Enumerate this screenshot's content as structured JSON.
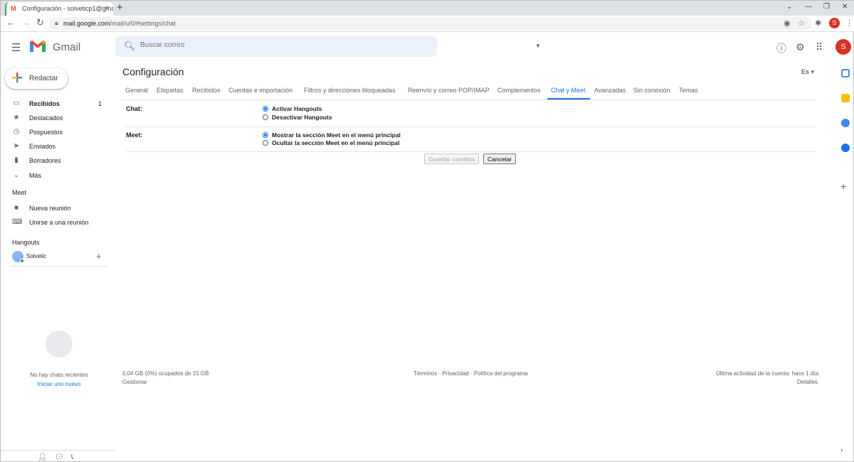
{
  "browser": {
    "tab_title": "Configuración - solveticp1@gmai",
    "tab_close": "×",
    "new_tab": "+",
    "url_host": "mail.google.com",
    "url_path": "/mail/u/0/#settings/chat",
    "profile_initial": "S",
    "window_controls": [
      "⌄",
      "—",
      "❐",
      "✕"
    ]
  },
  "header": {
    "app_name": "Gmail",
    "search_placeholder": "Buscar correo",
    "avatar_initial": "S"
  },
  "sidebar": {
    "compose_label": "Redactar",
    "items": [
      {
        "label": "Recibidos",
        "icon": "inbox-icon",
        "count": "1",
        "bold": true
      },
      {
        "label": "Destacados",
        "icon": "star-icon"
      },
      {
        "label": "Pospuestos",
        "icon": "clock-icon"
      },
      {
        "label": "Enviados",
        "icon": "send-icon"
      },
      {
        "label": "Borradores",
        "icon": "draft-icon"
      },
      {
        "label": "Más",
        "icon": "chevron-down-icon"
      }
    ],
    "meet_title": "Meet",
    "meet_items": [
      {
        "label": "Nueva reunión",
        "icon": "video-icon"
      },
      {
        "label": "Unirse a una reunión",
        "icon": "keyboard-icon"
      }
    ],
    "hangouts_title": "Hangouts",
    "hangouts_user": "Solvetic",
    "no_chats": "No hay chats recientes",
    "start_new": "Iniciar uno nuevo"
  },
  "settings": {
    "title": "Configuración",
    "lang": "Es",
    "tabs": [
      {
        "label": "General",
        "active": false
      },
      {
        "label": "Etiquetas",
        "active": false
      },
      {
        "label": "Recibidos",
        "active": false
      },
      {
        "label": "Cuentas e importación",
        "active": false
      },
      {
        "label": "Filtros y direcciones bloqueadas",
        "active": false
      },
      {
        "label": "Reenvío y correo POP/IMAP",
        "active": false
      },
      {
        "label": "Complementos",
        "active": false
      },
      {
        "label": "Chat y Meet",
        "active": true
      },
      {
        "label": "Avanzadas",
        "active": false
      },
      {
        "label": "Sin conexión",
        "active": false
      },
      {
        "label": "Temas",
        "active": false
      }
    ],
    "chat_label": "Chat:",
    "chat_options": [
      {
        "label": "Activar Hangouts",
        "selected": true
      },
      {
        "label": "Desactivar Hangouts",
        "selected": false
      }
    ],
    "meet_label": "Meet:",
    "meet_options": [
      {
        "label": "Mostrar la sección Meet en el menú principal",
        "selected": true
      },
      {
        "label": "Ocultar la sección Meet en el menú principal",
        "selected": false
      }
    ],
    "save_label": "Guardar cambios",
    "cancel_label": "Cancelar"
  },
  "footer": {
    "storage": "0,04 GB (0%) ocupados de 15 GB",
    "manage": "Gestionar",
    "policies": "Términos · Privacidad · Política del programa",
    "last_activity": "Última actividad de la cuenta: hace 1 día",
    "details": "Detalles"
  },
  "colors": {
    "accent": "#1a73e8",
    "brand_red": "#ea4335",
    "online": "#34a853"
  }
}
